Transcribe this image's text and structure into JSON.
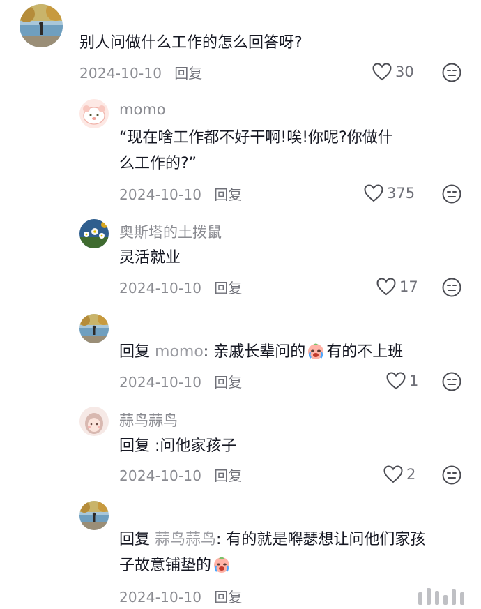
{
  "comments": [
    {
      "username": "",
      "text": "别人问做什么工作的怎么回答呀?",
      "date": "2024-10-10",
      "reply_label": "回复",
      "likes": "30"
    },
    {
      "username": "momo",
      "text_line1": "“现在啥工作都不好干啊!唉!你呢?你做什",
      "text_line2": "么工作的?”",
      "date": "2024-10-10",
      "reply_label": "回复",
      "likes": "375"
    },
    {
      "username": "奥斯塔的土拨鼠",
      "text": "灵活就业",
      "date": "2024-10-10",
      "reply_label": "回复",
      "likes": "17"
    },
    {
      "username": "",
      "reply_prefix": "回复",
      "reply_to": "momo",
      "text_before_emoji": ": 亲戚长辈问的",
      "text_after_emoji": "有的不上班",
      "date": "2024-10-10",
      "reply_label": "回复",
      "likes": "1"
    },
    {
      "username": "蒜鸟蒜鸟",
      "text": "回复 :问他家孩子",
      "date": "2024-10-10",
      "reply_label": "回复",
      "likes": "2"
    },
    {
      "username": "",
      "reply_prefix": "回复",
      "reply_to": "蒜鸟蒜鸟",
      "text_line1_rest": ": 有的就是嘚瑟想让问他们家孩",
      "text_line2": "子故意铺垫的",
      "date": "2024-10-10",
      "reply_label": "回复"
    }
  ],
  "icons": {
    "like": "heart-outline-icon",
    "dislike": "meh-face-icon",
    "emoji": "crying-face-emoji"
  },
  "colors": {
    "text": "#161823",
    "secondary": "#8a8b91",
    "mention": "#9b9ca2"
  }
}
